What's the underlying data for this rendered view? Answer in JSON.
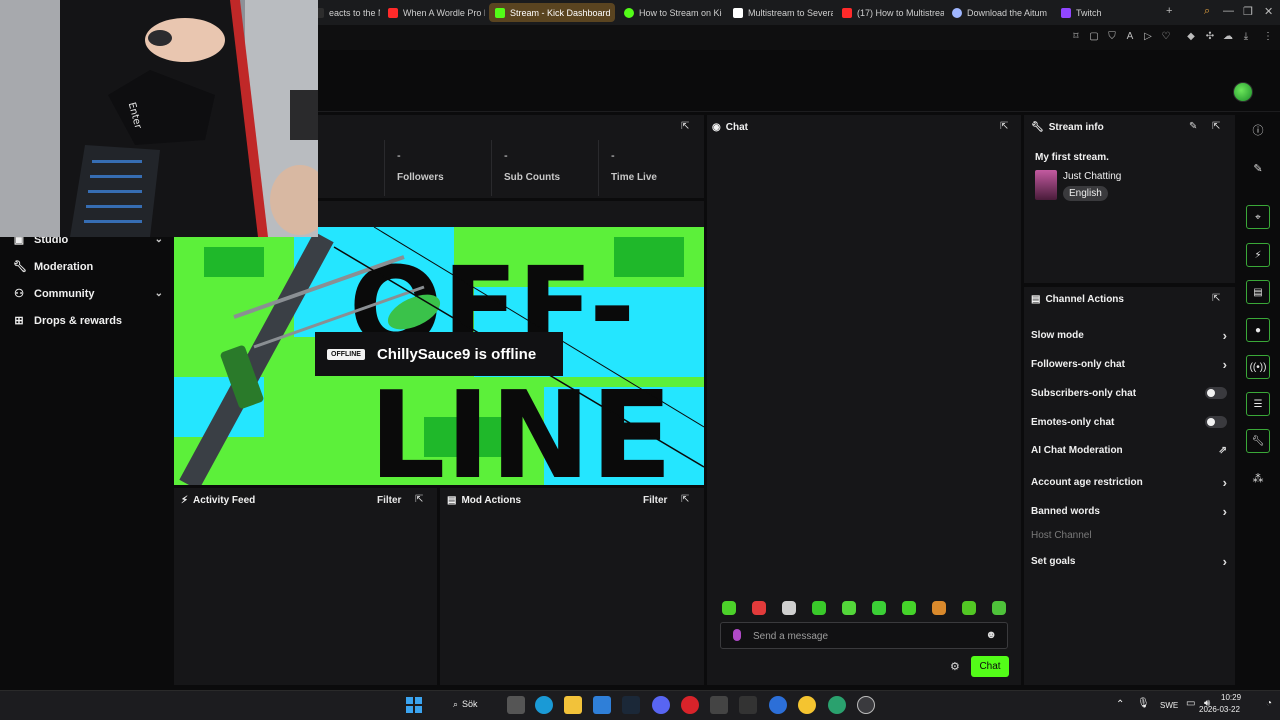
{
  "browser": {
    "tabs": [
      {
        "label": "eacts to the N",
        "color": "#2d2d2d"
      },
      {
        "label": "When A Wordle Pro P",
        "color": "#ff2a2a"
      },
      {
        "label": "Stream - Kick Dashboard",
        "color": "#53fc18",
        "active": true
      },
      {
        "label": "How to Stream on Kic",
        "color": "#53fc18"
      },
      {
        "label": "Multistream to Severa",
        "color": "#ffffff"
      },
      {
        "label": "(17) How to Multistrea",
        "color": "#ff2a2a"
      },
      {
        "label": "Download the Aitum",
        "color": "#9fb6ff"
      },
      {
        "label": "Twitch",
        "color": "#9146ff"
      }
    ],
    "new_tab": "+"
  },
  "sidebar": {
    "items": [
      {
        "label": "Studio",
        "icon": "studio-icon",
        "chevron": true
      },
      {
        "label": "Moderation",
        "icon": "wrench-icon",
        "chevron": false
      },
      {
        "label": "Community",
        "icon": "community-icon",
        "chevron": true
      },
      {
        "label": "Drops & rewards",
        "icon": "gift-icon",
        "chevron": false
      }
    ]
  },
  "stats": [
    {
      "value": "",
      "label": "rs"
    },
    {
      "value": "-",
      "label": "Followers"
    },
    {
      "value": "-",
      "label": "Sub Counts"
    },
    {
      "value": "-",
      "label": "Time Live"
    }
  ],
  "offline": {
    "tag": "OFFLINE",
    "message": "ChillySauce9 is offline",
    "art_colors": {
      "green": "#5cf03a",
      "cyan": "#24e6ff",
      "black": "#0a0a0a"
    }
  },
  "activity_feed": {
    "title": "Activity Feed",
    "filter": "Filter"
  },
  "mod_actions": {
    "title": "Mod Actions",
    "filter": "Filter"
  },
  "chat": {
    "title": "Chat",
    "placeholder": "Send a message",
    "send_label": "Chat",
    "emote_colors": [
      "#4cd12a",
      "#e23b3b",
      "#cfcfcf",
      "#39c92a",
      "#53d63a",
      "#3bcf36",
      "#45d32a",
      "#d9892c",
      "#52c724",
      "#4ec23a"
    ]
  },
  "stream_info": {
    "title": "Stream info",
    "stream_title": "My first stream.",
    "category": "Just Chatting",
    "language": "English"
  },
  "channel_actions": {
    "title": "Channel Actions",
    "rows": [
      {
        "label": "Slow mode",
        "control": "chevron"
      },
      {
        "label": "Followers-only chat",
        "control": "chevron"
      },
      {
        "label": "Subscribers-only chat",
        "control": "toggle"
      },
      {
        "label": "Emotes-only chat",
        "control": "toggle"
      },
      {
        "label": "AI Chat Moderation",
        "control": "external"
      },
      {
        "label": "Account age restriction",
        "control": "chevron"
      },
      {
        "label": "Banned words",
        "control": "chevron"
      },
      {
        "label": "Host Channel",
        "control": "none"
      },
      {
        "label": "Set goals",
        "control": "chevron"
      }
    ]
  },
  "taskbar": {
    "search_label": "Sök",
    "language": "SWE",
    "time": "10:29",
    "date": "2026-03-22"
  },
  "colors": {
    "accent": "#53fc18",
    "panel": "#161618",
    "background": "#0b0b0c"
  }
}
